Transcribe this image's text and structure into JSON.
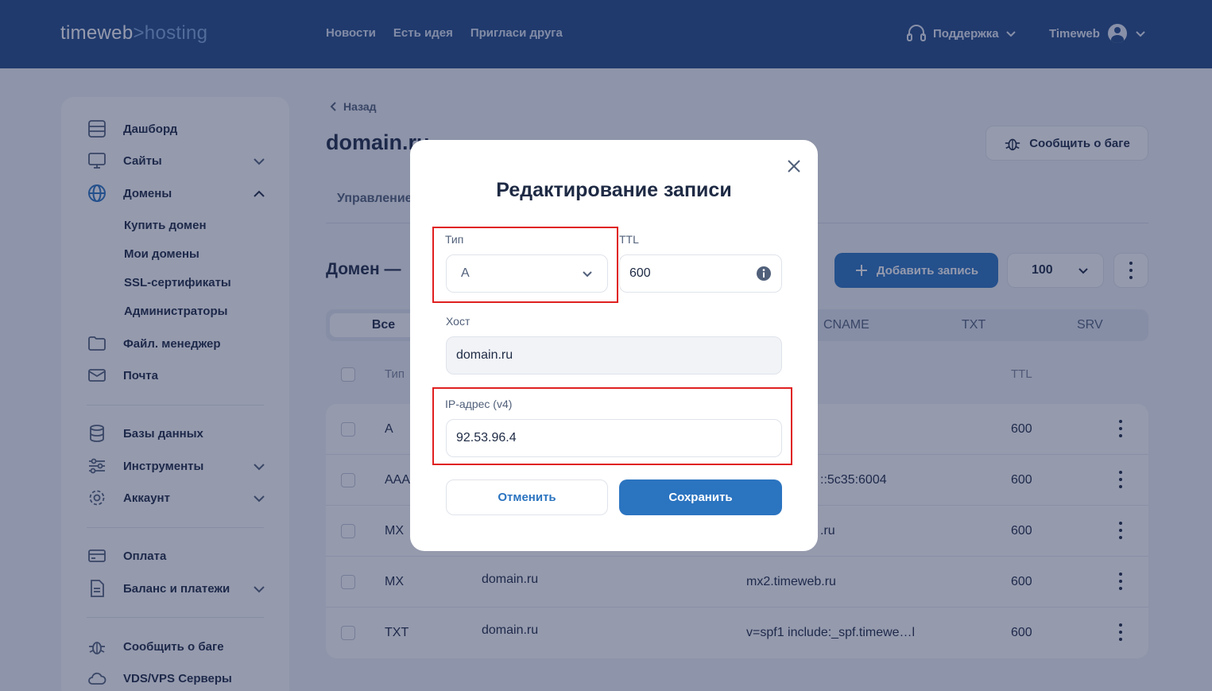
{
  "header": {
    "logo_main": "timeweb",
    "logo_sep": ">",
    "logo_sub": "hosting",
    "nav": [
      "Новости",
      "Есть идея",
      "Пригласи друга"
    ],
    "support": "Поддержка",
    "user": "Timeweb"
  },
  "sidebar": {
    "dashboard": "Дашборд",
    "sites": "Сайты",
    "domains": "Домены",
    "domains_sub": [
      "Купить домен",
      "Мои домены",
      "SSL-сертификаты",
      "Администраторы"
    ],
    "file_manager": "Файл. менеджер",
    "mail": "Почта",
    "databases": "Базы данных",
    "tools": "Инструменты",
    "account": "Аккаунт",
    "payment": "Оплата",
    "balance": "Баланс и платежи",
    "report_bug": "Сообщить о баге",
    "vds": "VDS/VPS Серверы"
  },
  "main": {
    "back": "Назад",
    "title": "domain.ru",
    "report_bug": "Сообщить о баге",
    "tab_management": "Управление",
    "domain_heading": "Домен —",
    "add_record": "Добавить запись",
    "per_page": "100",
    "filters": {
      "all": "Все",
      "cname": "CNAME",
      "txt": "TXT",
      "srv": "SRV"
    },
    "columns": {
      "type": "Тип",
      "ttl": "TTL"
    },
    "rows": [
      {
        "type": "A",
        "host": "",
        "value": "",
        "ttl": "600"
      },
      {
        "type": "AAAA",
        "host": "",
        "value": "::5c35:6004",
        "ttl": "600"
      },
      {
        "type": "MX",
        "host": "",
        "value": ".ru",
        "ttl": "600"
      },
      {
        "type": "MX",
        "host": "domain.ru",
        "value": "mx2.timeweb.ru",
        "ttl": "600"
      },
      {
        "type": "TXT",
        "host": "domain.ru",
        "value": "v=spf1 include:_spf.timewe…l",
        "ttl": "600"
      }
    ]
  },
  "modal": {
    "title": "Редактирование записи",
    "type_label": "Тип",
    "type_value": "A",
    "ttl_label": "TTL",
    "ttl_value": "600",
    "host_label": "Хост",
    "host_value": "domain.ru",
    "ip_label": "IP-адрес (v4)",
    "ip_value": "92.53.96.4",
    "cancel": "Отменить",
    "save": "Сохранить"
  },
  "colors": {
    "header_bg": "#234a86",
    "primary": "#2b74c0",
    "highlight": "#e02020"
  }
}
